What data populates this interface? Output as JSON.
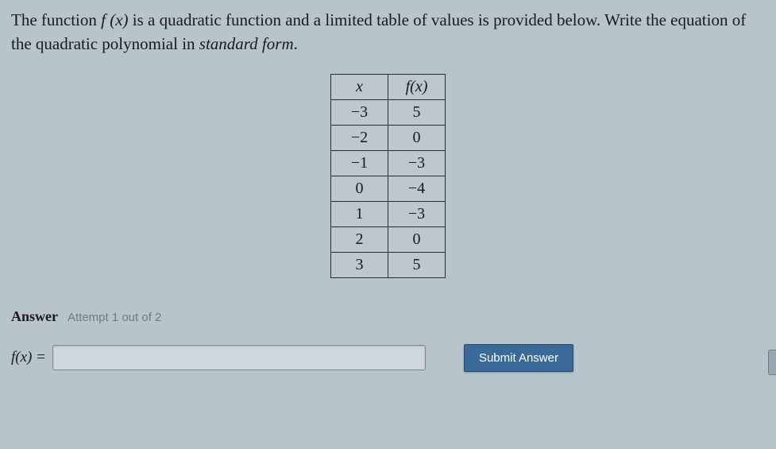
{
  "prompt": {
    "part1": "The function ",
    "fn": "f (x)",
    "part2": " is a quadratic function and a limited table of values is provided below. Write the equation of the quadratic polynomial in ",
    "emph": "standard form",
    "part3": "."
  },
  "table": {
    "headers": {
      "x": "x",
      "fx": "f(x)"
    },
    "rows": [
      {
        "x": "−3",
        "fx": "5"
      },
      {
        "x": "−2",
        "fx": "0"
      },
      {
        "x": "−1",
        "fx": "−3"
      },
      {
        "x": "0",
        "fx": "−4"
      },
      {
        "x": "1",
        "fx": "−3"
      },
      {
        "x": "2",
        "fx": "0"
      },
      {
        "x": "3",
        "fx": "5"
      }
    ]
  },
  "answer": {
    "label": "Answer",
    "attempt": "Attempt 1 out of 2",
    "fx_eq": "f(x) =",
    "value": "",
    "submit": "Submit Answer"
  }
}
